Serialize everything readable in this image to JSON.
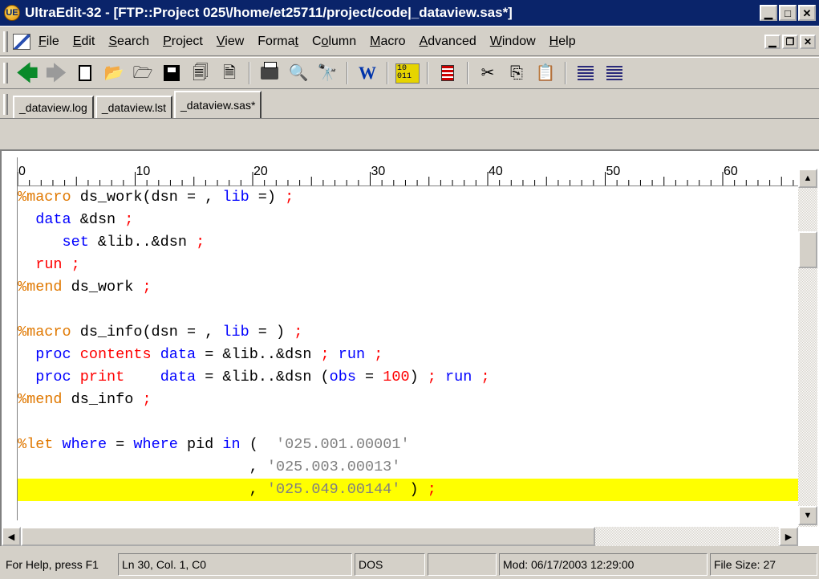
{
  "window": {
    "title": "UltraEdit-32 - [FTP::Project 025\\/home/et25711/project/code|_dataview.sas*]",
    "app_icon_letters": "UE"
  },
  "menu": {
    "items": [
      {
        "label": "File",
        "key": "F"
      },
      {
        "label": "Edit",
        "key": "E"
      },
      {
        "label": "Search",
        "key": "S"
      },
      {
        "label": "Project",
        "key": "P"
      },
      {
        "label": "View",
        "key": "V"
      },
      {
        "label": "Format",
        "key": "t"
      },
      {
        "label": "Column",
        "key": "o"
      },
      {
        "label": "Macro",
        "key": "M"
      },
      {
        "label": "Advanced",
        "key": "A"
      },
      {
        "label": "Window",
        "key": "W"
      },
      {
        "label": "Help",
        "key": "H"
      }
    ]
  },
  "toolbar": {
    "icons": [
      "back-arrow-icon",
      "forward-arrow-icon",
      "new-file-icon",
      "open-file-icon",
      "open-ftp-icon",
      "save-icon",
      "save-all-icon",
      "close-file-icon",
      "print-icon",
      "print-preview-icon",
      "find-icon",
      "word-wrap-icon",
      "hex-mode-icon",
      "column-ruler-icon",
      "cut-icon",
      "copy-icon",
      "paste-icon",
      "align-left-icon",
      "align-right-icon"
    ],
    "hex_label": "10 011"
  },
  "tabs": [
    {
      "label": "_dataview.log",
      "active": false
    },
    {
      "label": "_dataview.lst",
      "active": false
    },
    {
      "label": "_dataview.sas*",
      "active": true
    }
  ],
  "ruler": {
    "labels": [
      "0",
      "10",
      "20",
      "30",
      "40",
      "50",
      "60"
    ]
  },
  "code": {
    "line_1": {
      "m1": "%macro",
      "t1": " ds_work(dsn = , ",
      "b1": "lib",
      "t2": " =) ",
      "r1": ";"
    },
    "line_2": {
      "pad": "  ",
      "b1": "data",
      "t1": " &dsn ",
      "r1": ";"
    },
    "line_3": {
      "pad": "     ",
      "b1": "set",
      "t1": " &lib..&dsn ",
      "r1": ";"
    },
    "line_4": {
      "pad": "  ",
      "b1": "run",
      "t1": " ",
      "r1": ";"
    },
    "line_5": {
      "m1": "%mend",
      "t1": " ds_work ",
      "r1": ";"
    },
    "line_7": {
      "m1": "%macro",
      "t1": " ds_info(dsn = , ",
      "b1": "lib",
      "t2": " = ) ",
      "r1": ";"
    },
    "line_8": {
      "pad": "  ",
      "b1": "proc",
      "t1": " ",
      "r1": "contents",
      "t2": " ",
      "b2": "data",
      "t3": " = &lib..&dsn ",
      "r2": ";",
      "t4": " ",
      "b3": "run",
      "t5": " ",
      "r3": ";"
    },
    "line_9": {
      "pad": "  ",
      "b1": "proc",
      "t1": " ",
      "r1": "print",
      "t2": "    ",
      "b2": "data",
      "t3": " = &lib..&dsn (",
      "b3": "obs",
      "t4": " = ",
      "r2": "100",
      "t5": ") ",
      "r3": ";",
      "t6": " ",
      "b4": "run",
      "t7": " ",
      "r4": ";"
    },
    "line_10": {
      "m1": "%mend",
      "t1": " ds_info ",
      "r1": ";"
    },
    "line_12": {
      "m1": "%let",
      "t1": " ",
      "b1": "where",
      "t2": " = ",
      "b2": "where",
      "t3": " pid ",
      "b3": "in",
      "t4": " (  ",
      "s1": "'025.001.00001'"
    },
    "line_13": {
      "pad": "                          , ",
      "s1": "'025.003.00013'"
    },
    "line_14": {
      "pad": "                          , ",
      "s1": "'025.049.00144'",
      "t1": " ) ",
      "r1": ";"
    }
  },
  "status": {
    "help": "For Help, press F1",
    "position": "Ln 30, Col. 1, C0",
    "format": "DOS",
    "modified": "Mod: 06/17/2003 12:29:00",
    "size": "File Size: 27"
  },
  "colors": {
    "macro": "#e07800",
    "keyword": "#0000ff",
    "operator": "#ff0000",
    "string": "#808080",
    "highlight": "#ffff00",
    "titlebar": "#0a246a"
  }
}
